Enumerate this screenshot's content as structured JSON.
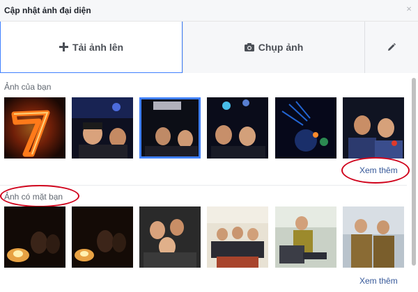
{
  "header": {
    "title": "Cập nhật ảnh đại diện",
    "close_symbol": "×"
  },
  "tabs": {
    "upload_label": "Tải ảnh lên",
    "camera_label": "Chụp ảnh"
  },
  "sections": {
    "your_photos": {
      "title": "Ảnh của bạn",
      "see_more": "Xem thêm"
    },
    "photos_of_you": {
      "title": "Ảnh có mặt bạn",
      "see_more": "Xem thêm"
    }
  },
  "colors": {
    "accent": "#4080ff",
    "link": "#365899",
    "annotation": "#d0021b"
  }
}
